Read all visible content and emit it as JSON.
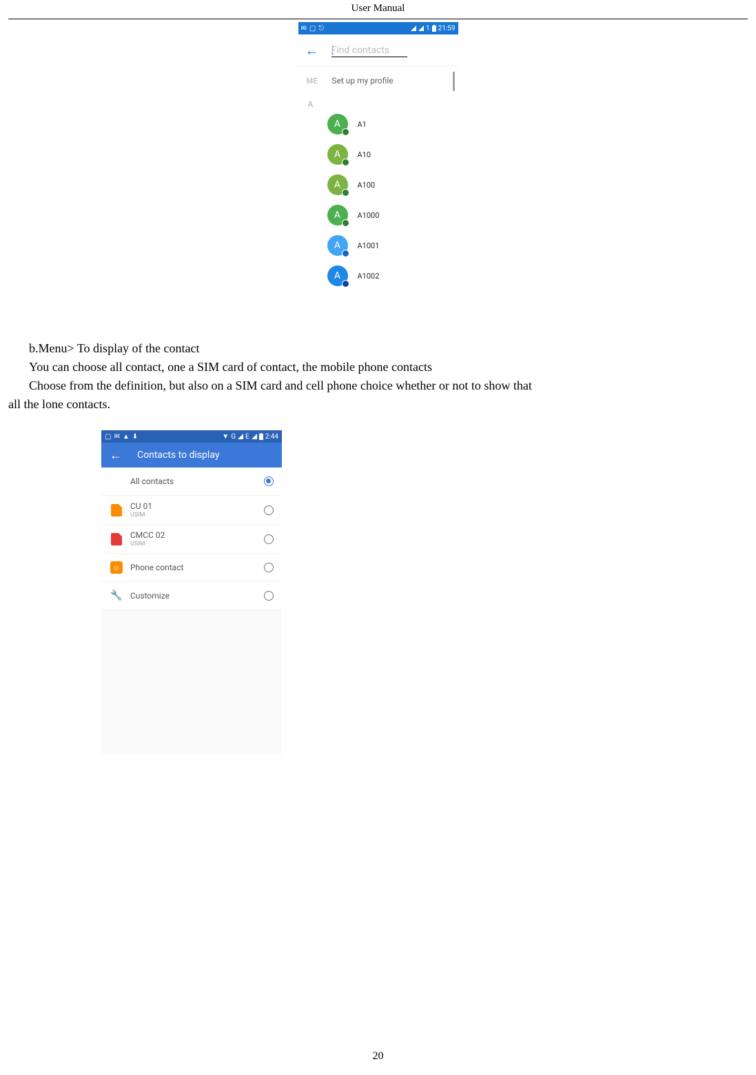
{
  "header": "User    Manual",
  "pageNumber": "20",
  "body": {
    "p1": "b.Menu> To display of the contact",
    "p2": "You can choose all contact, one a SIM card of contact, the mobile phone contacts",
    "p3": "Choose from the definition, but also on a SIM card and cell phone choice whether or not to show      that",
    "p4": "all the lone contacts."
  },
  "phone1": {
    "statusTime": "21:59",
    "signalLabel": "1",
    "searchPlaceholder": "Find contacts",
    "meLabel": "ME",
    "meText": "Set up my profile",
    "sectionLetter": "A",
    "contacts": [
      {
        "name": "A1",
        "letter": "A",
        "color": "#4CAF50",
        "mini": "#2E7D32"
      },
      {
        "name": "A10",
        "letter": "A",
        "color": "#7CB342",
        "mini": "#2E7D32"
      },
      {
        "name": "A100",
        "letter": "A",
        "color": "#7CB342",
        "mini": "#2E7D32"
      },
      {
        "name": "A1000",
        "letter": "A",
        "color": "#4CAF50",
        "mini": "#2E7D32"
      },
      {
        "name": "A1001",
        "letter": "A",
        "color": "#42A5F5",
        "mini": "#1565C0"
      },
      {
        "name": "A1002",
        "letter": "A",
        "color": "#1E88E5",
        "mini": "#0D47A1"
      }
    ]
  },
  "phone2": {
    "statusTime": "2:44",
    "statusNet": "G",
    "statusE": "E",
    "title": "Contacts to display",
    "options": [
      {
        "label": "All contacts",
        "sub": "",
        "type": "spacer",
        "checked": true
      },
      {
        "label": "CU 01",
        "sub": "USIM",
        "type": "sim-orange",
        "checked": false
      },
      {
        "label": "CMCC 02",
        "sub": "USIM",
        "type": "sim-red",
        "checked": false
      },
      {
        "label": "Phone contact",
        "sub": "",
        "type": "phone",
        "checked": false
      },
      {
        "label": "Customize",
        "sub": "",
        "type": "wrench",
        "checked": false
      }
    ],
    "statusIcons": [
      "□",
      "▲",
      "✉",
      "⚠",
      "⬇"
    ]
  }
}
